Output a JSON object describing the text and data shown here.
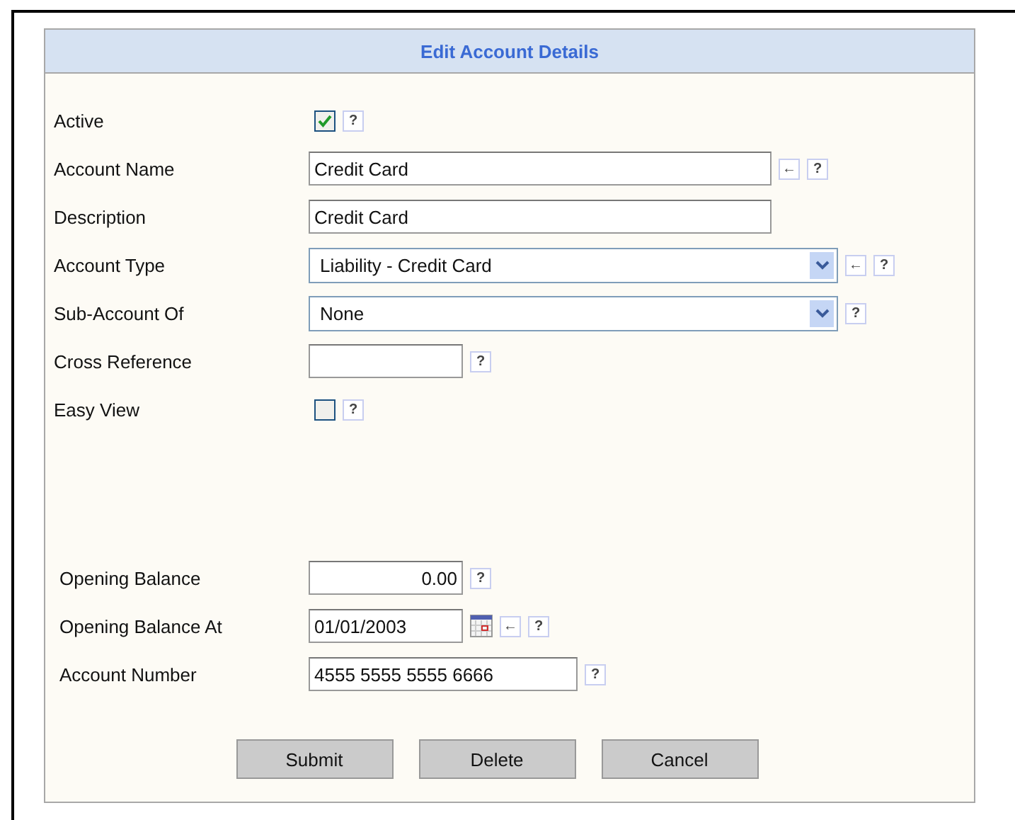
{
  "title": "Edit Account Details",
  "sections": [
    [
      {
        "label": "Active",
        "kind": "checkbox",
        "checked": true,
        "help": "?"
      },
      {
        "label": "Account Name",
        "kind": "text",
        "value": "Credit Card",
        "arrow": "←",
        "help": "?"
      },
      {
        "label": "Description",
        "kind": "text",
        "value": "Credit Card"
      },
      {
        "label": "Account Type",
        "kind": "select",
        "value": "Liability - Credit Card",
        "arrow": "←",
        "help": "?"
      },
      {
        "label": "Sub-Account Of",
        "kind": "select",
        "value": "None",
        "help": "?"
      },
      {
        "label": "Cross Reference",
        "kind": "short",
        "help": "?"
      },
      {
        "label": "Easy View",
        "kind": "checkbox",
        "checked": false,
        "help": "?"
      }
    ],
    [
      {
        "label": "Opening Balance",
        "kind": "amount",
        "value": "0.00",
        "help": "?"
      },
      {
        "label": "Opening Balance At",
        "kind": "date",
        "value": "01/01/2003",
        "arrow": "←",
        "help": "?"
      },
      {
        "label": "Account Number",
        "kind": "number",
        "value": "4555 5555 5555 6666",
        "help": "?"
      }
    ]
  ],
  "buttons": [
    "Submit",
    "Delete",
    "Cancel"
  ]
}
